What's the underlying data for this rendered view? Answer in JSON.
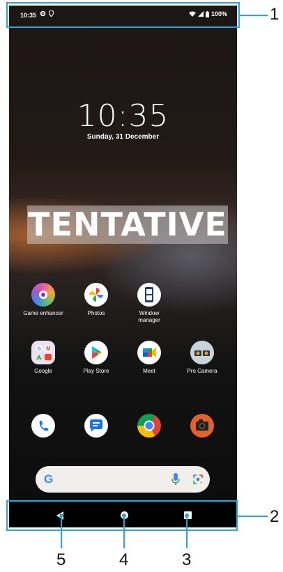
{
  "status_bar": {
    "time": "10:35",
    "battery": "100%",
    "icons": [
      "settings-gear-icon",
      "location-icon",
      "wifi-icon",
      "signal-icon",
      "battery-icon"
    ]
  },
  "lock": {
    "clock": "10:35",
    "date": "Sunday, 31 December"
  },
  "watermark": "TENTATIVE",
  "apps_row1": [
    {
      "label": "Game enhancer",
      "icon": "game-enhancer-icon"
    },
    {
      "label": "Photos",
      "icon": "photos-icon"
    },
    {
      "label": "Window manager",
      "icon": "window-manager-icon"
    }
  ],
  "apps_row2": [
    {
      "label": "Google",
      "icon": "google-folder-icon"
    },
    {
      "label": "Play Store",
      "icon": "play-store-icon"
    },
    {
      "label": "Meet",
      "icon": "meet-icon"
    },
    {
      "label": "Pro Camera",
      "icon": "pro-camera-icon"
    }
  ],
  "dock": [
    {
      "icon": "phone-icon"
    },
    {
      "icon": "messages-icon"
    },
    {
      "icon": "chrome-icon"
    },
    {
      "icon": "camera-icon"
    }
  ],
  "search": {
    "logo": "G",
    "icons": [
      "mic-icon",
      "lens-icon"
    ]
  },
  "nav": {
    "icons": [
      "back-icon",
      "home-icon",
      "recents-icon"
    ]
  },
  "callouts": {
    "status": "1",
    "navbar": "2",
    "recents": "3",
    "home": "4",
    "back": "5"
  },
  "colors": {
    "callout_frame": "#2aa6de",
    "search_bg": "#f1efec"
  }
}
